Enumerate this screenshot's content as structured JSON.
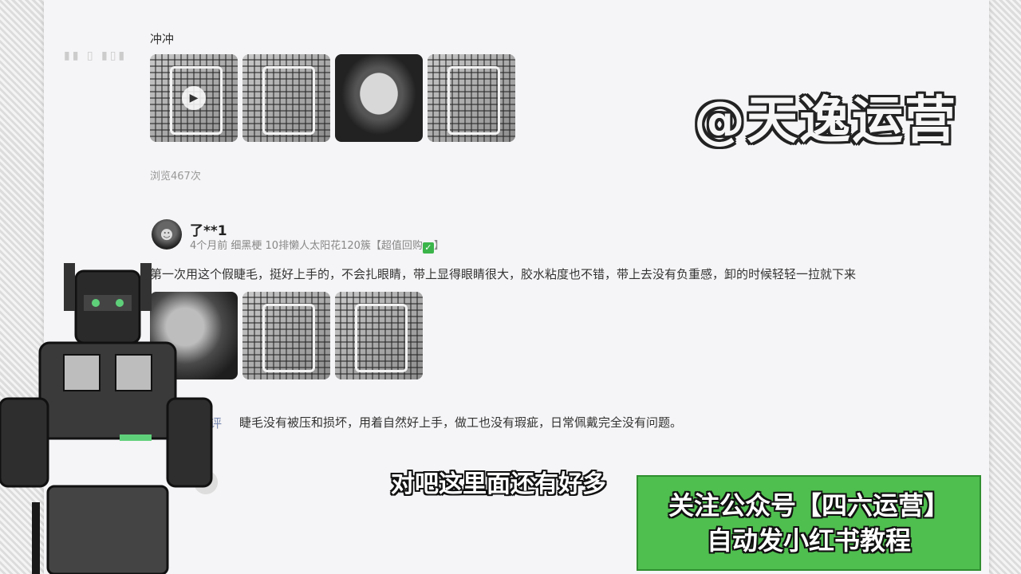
{
  "review1": {
    "text_tail": "冲冲",
    "views": "浏览467次"
  },
  "review2": {
    "username": "了**1",
    "meta": "4个月前 细黑梗 10排懒人太阳花120簇【超值回购",
    "meta_close": "】",
    "text": "第一次用这个假睫毛，挺好上手的，不会扎眼睛，带上显得眼睛很大，胶水粘度也不错，带上去没有负重感，卸的时候轻轻一拉就下来"
  },
  "followup": {
    "label": "后追评",
    "text": "睫毛没有被压和损坏，用着自然好上手，做工也没有瑕疵，日常佩戴完全没有问题。"
  },
  "overlay": {
    "watermark": "@天逸运营",
    "subtitle": "对吧这里面还有好多",
    "promo_line1": "关注公众号【四六运营】",
    "promo_line2": "自动发小红书教程"
  }
}
